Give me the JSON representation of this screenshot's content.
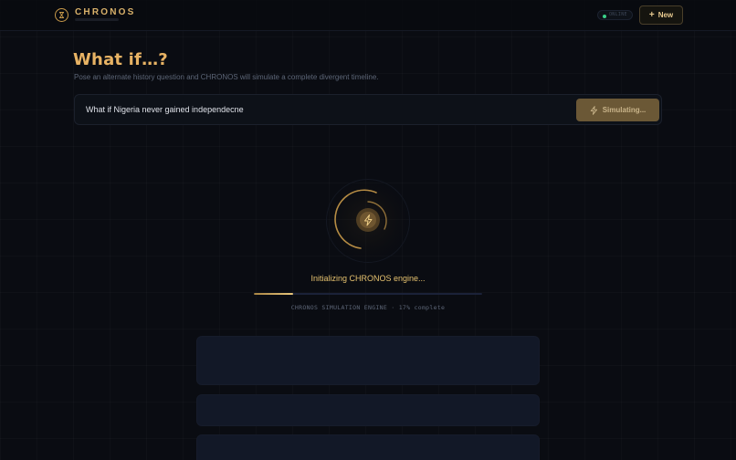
{
  "header": {
    "brand": "CHRONOS",
    "status_label": "ONLINE",
    "new_button_label": "New"
  },
  "hero": {
    "title": "What if…?",
    "subtitle": "Pose an alternate history question and CHRONOS will simulate a complete divergent timeline."
  },
  "query": {
    "value": "What if Nigeria never gained independecne",
    "button_label": "Simulating..."
  },
  "progress": {
    "status": "Initializing CHRONOS engine...",
    "caption": "CHRONOS SIMULATION ENGINE · 17% complete",
    "percent": 17
  },
  "colors": {
    "accent": "#e8b364",
    "background": "#0a0c12",
    "progress_fill": "#e8c67c",
    "status_dot": "#3ad08a"
  },
  "icons": {
    "logo": "hourglass-icon",
    "new": "plus-icon",
    "simulate": "lightning-icon",
    "loader": "lightning-icon"
  }
}
